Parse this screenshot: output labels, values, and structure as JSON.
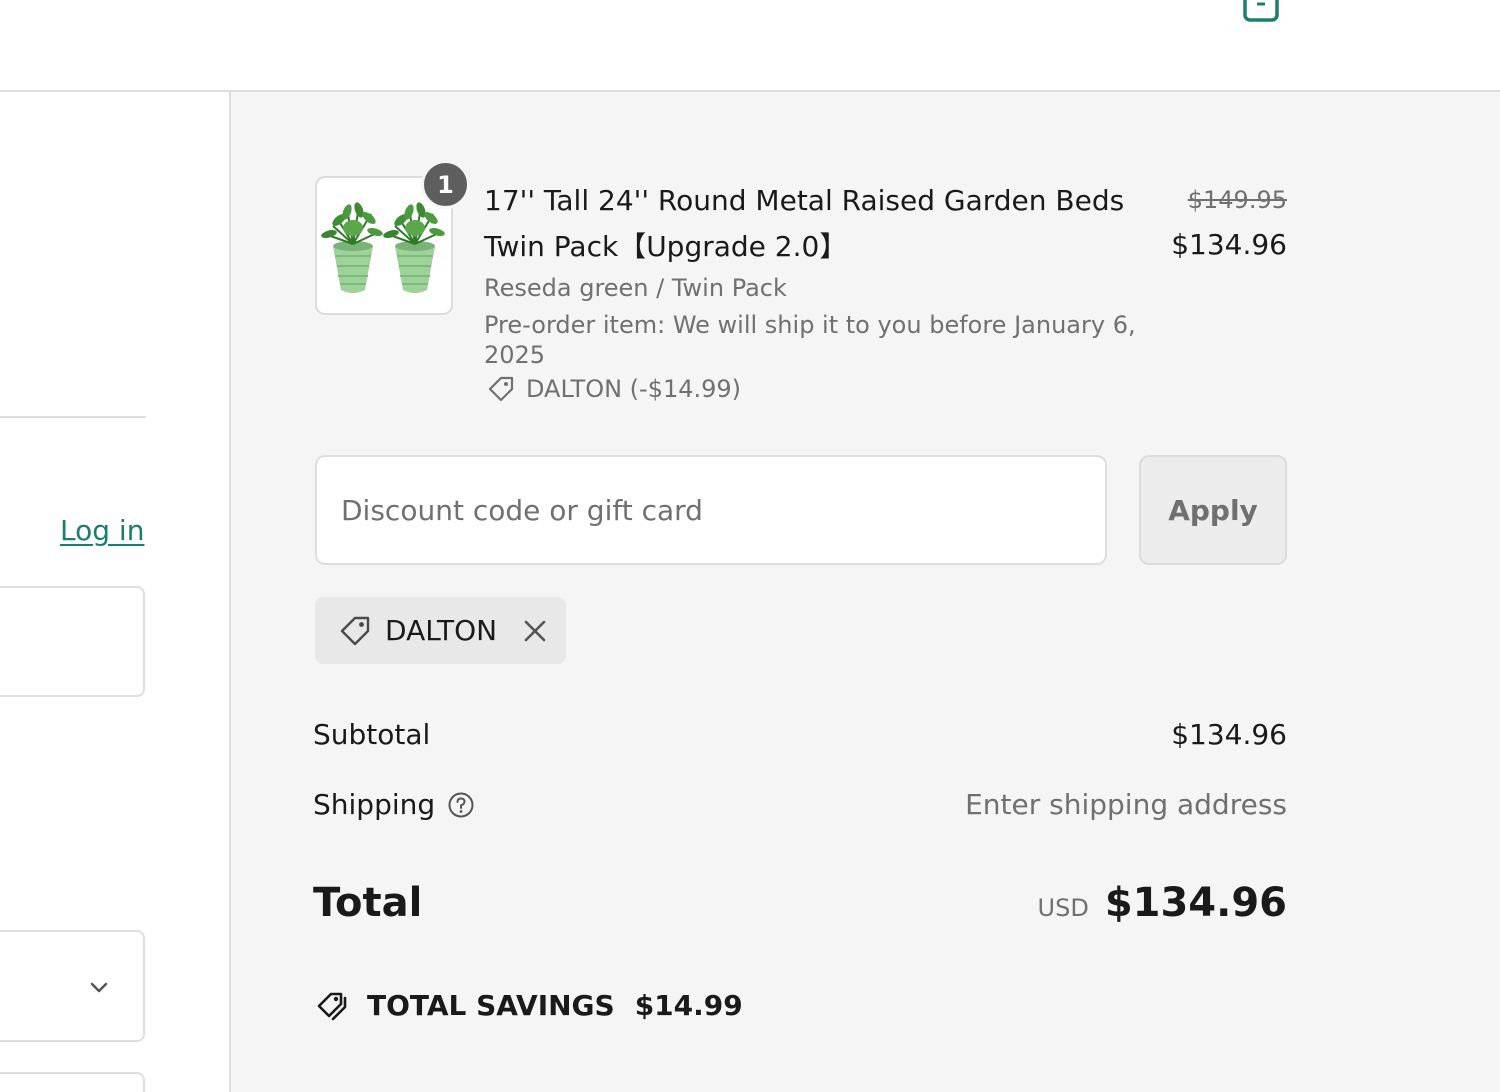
{
  "header": {
    "cart_icon": "shopping-bag-icon"
  },
  "left": {
    "login_link": "Log in",
    "chevron_icon": "chevron-down-icon"
  },
  "order": {
    "item": {
      "quantity": "1",
      "title": "17'' Tall 24'' Round Metal Raised Garden Beds Twin Pack【Upgrade 2.0】",
      "variant": "Reseda green / Twin Pack",
      "preorder_note": "Pre-order item: We will ship it to you before January 6, 2025",
      "discount_line": "DALTON (-$14.99)",
      "price_original": "$149.95",
      "price_final": "$134.96",
      "image_icon": "garden-bed-product-image"
    },
    "discount": {
      "placeholder": "Discount code or gift card",
      "value": "",
      "apply_label": "Apply"
    },
    "applied_code": {
      "label": "DALTON",
      "tag_icon": "tag-icon",
      "remove_icon": "close-icon"
    },
    "subtotal": {
      "label": "Subtotal",
      "value": "$134.96"
    },
    "shipping": {
      "label": "Shipping",
      "value": "Enter shipping address",
      "help_icon": "question-circle-icon"
    },
    "total": {
      "label": "Total",
      "currency": "USD",
      "value": "$134.96"
    },
    "savings": {
      "label": "TOTAL SAVINGS",
      "value": "$14.99",
      "icon": "tags-icon"
    }
  },
  "colors": {
    "accent": "#1a7f6b",
    "panel_bg": "#f5f5f5",
    "muted_text": "#707070",
    "badge_bg": "#5e5e5e"
  }
}
